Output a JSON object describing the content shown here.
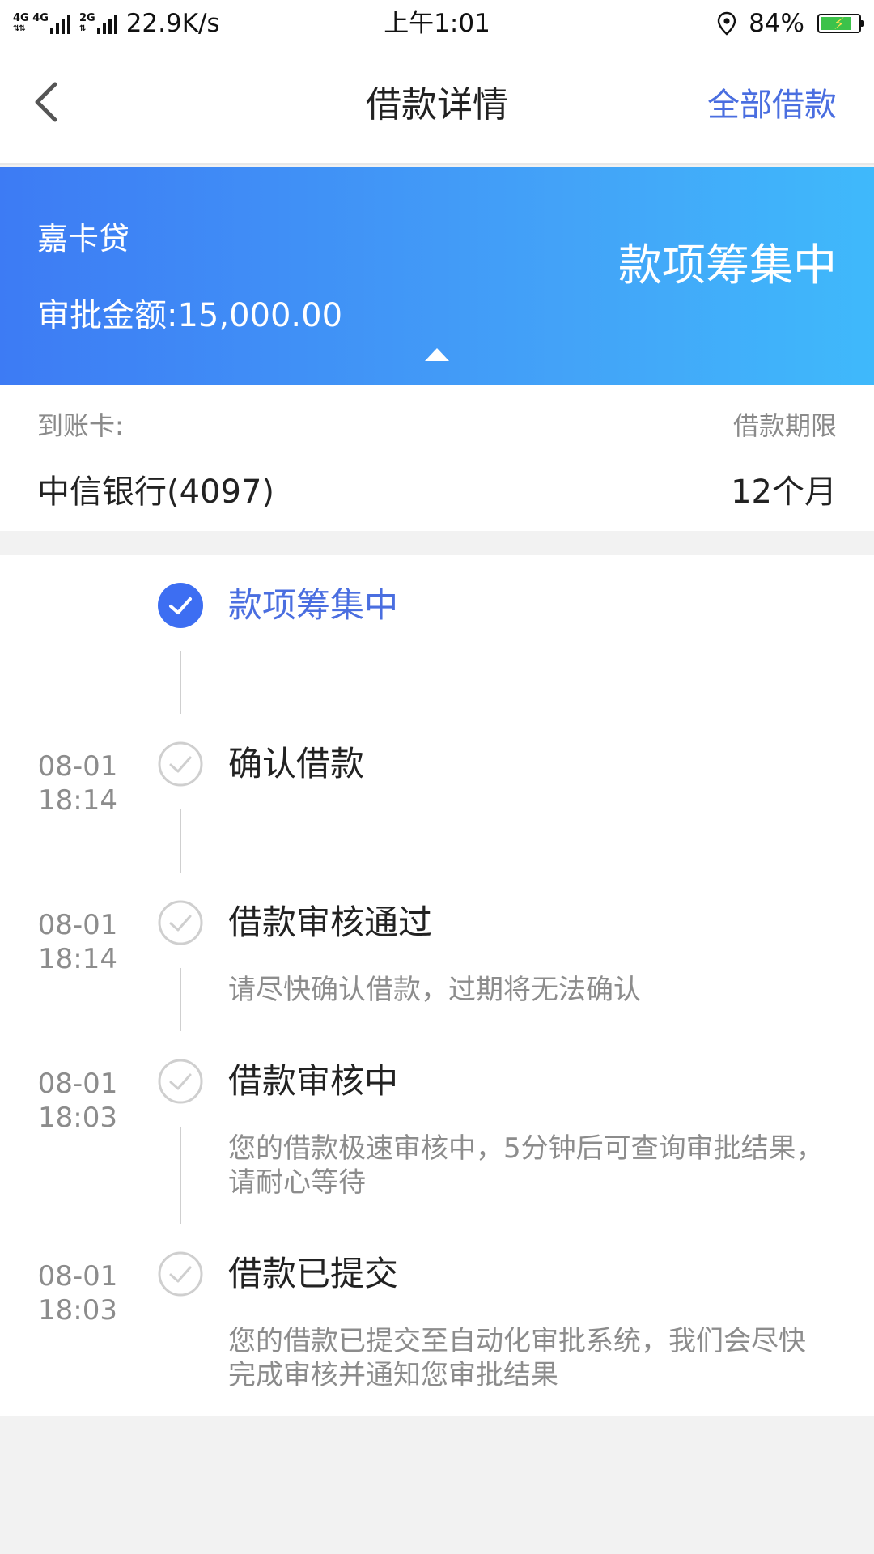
{
  "status_bar": {
    "network_label": "4G 4G",
    "network2_label": "2G",
    "speed": "22.9K/s",
    "time": "上午1:01",
    "battery_percent": "84%",
    "battery_level": 0.84,
    "icons": [
      "signal-icon",
      "location-icon",
      "battery-icon"
    ]
  },
  "nav": {
    "back_icon": "chevron-left-icon",
    "title": "借款详情",
    "right_link": "全部借款"
  },
  "banner": {
    "product_name": "嘉卡贷",
    "approved_amount": "审批金额:15,000.00",
    "status": "款项筹集中",
    "colors": {
      "gradient_start": "#3d7bf4",
      "gradient_end": "#3fb9fb"
    }
  },
  "account": {
    "card_label": "到账卡:",
    "card_value": "中信银行(4097)",
    "term_label": "借款期限",
    "term_value": "12个月"
  },
  "timeline": {
    "active_color": "#3d6ef2",
    "steps": [
      {
        "date": "",
        "time": "",
        "title": "款项筹集中",
        "desc": "",
        "state": "active"
      },
      {
        "date": "08-01",
        "time": "18:14",
        "title": "确认借款",
        "desc": "",
        "state": "done"
      },
      {
        "date": "08-01",
        "time": "18:14",
        "title": "借款审核通过",
        "desc": "请尽快确认借款，过期将无法确认",
        "state": "done"
      },
      {
        "date": "08-01",
        "time": "18:03",
        "title": "借款审核中",
        "desc": "您的借款极速审核中，5分钟后可查询审批结果，请耐心等待",
        "state": "done"
      },
      {
        "date": "08-01",
        "time": "18:03",
        "title": "借款已提交",
        "desc": "您的借款已提交至自动化审批系统，我们会尽快完成审核并通知您审批结果",
        "state": "done"
      }
    ]
  }
}
